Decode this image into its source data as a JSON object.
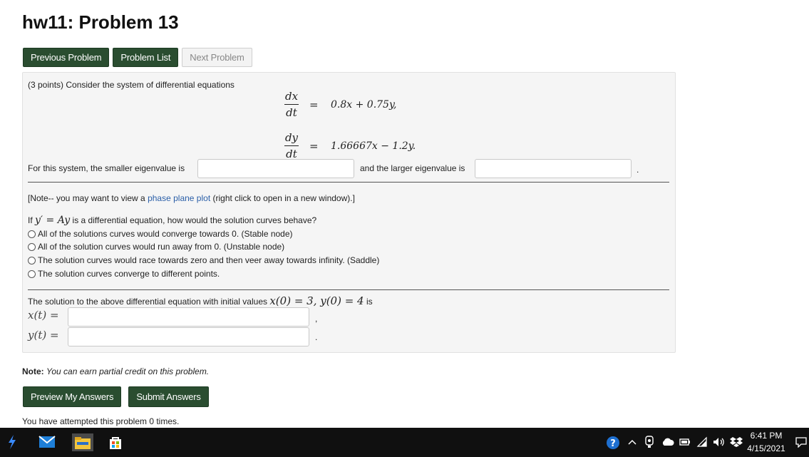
{
  "page": {
    "title": "hw11: Problem 13"
  },
  "nav": {
    "previous": "Previous Problem",
    "list": "Problem List",
    "next": "Next Problem"
  },
  "problem": {
    "intro": "(3 points) Consider the system of differential equations",
    "eq1_num": "dx",
    "eq1_den": "dt",
    "eq1_rhs": "0.8x + 0.75y,",
    "eq2_num": "dy",
    "eq2_den": "dt",
    "eq2_rhs": "1.66667x − 1.2y.",
    "equals": "=",
    "eigen_prefix": "For this system, the smaller eigenvalue is",
    "eigen_middle": "and the larger eigenvalue is",
    "eigen_end": ".",
    "note_prefix": "[Note-- you may want to view a",
    "note_link": "phase plane plot",
    "note_suffix": "(right click to open in a new window).]",
    "question_prefix": "If",
    "question_math": "y′ = Ay",
    "question_suffix": "is a differential equation, how would the solution curves behave?",
    "options": [
      "All of the solutions curves would converge towards 0. (Stable node)",
      "All of the solution curves would run away from 0. (Unstable node)",
      "The solution curves would race towards zero and then veer away towards infinity. (Saddle)",
      "The solution curves converge to different points."
    ],
    "ivp_prefix": "The solution to the above differential equation with initial values",
    "ivp_math": "x(0) = 3,  y(0) = 4",
    "ivp_suffix": "is",
    "x_label": "x(t) =",
    "x_end": ",",
    "y_label": "y(t) =",
    "y_end": "."
  },
  "note": {
    "bold": "Note:",
    "text": "You can earn partial credit on this problem."
  },
  "actions": {
    "preview": "Preview My Answers",
    "submit": "Submit Answers"
  },
  "attempts": "You have attempted this problem 0 times.",
  "taskbar": {
    "icons": [
      "app-launcher-icon",
      "mail-icon",
      "file-explorer-icon",
      "store-icon"
    ],
    "tray_icons": [
      "help-icon",
      "chevron-up-icon",
      "webcam-icon",
      "cloud-icon",
      "battery-icon",
      "wifi-icon",
      "volume-icon",
      "dropbox-icon",
      "notification-icon"
    ],
    "time": "6:41 PM",
    "date": "4/15/2021"
  },
  "colors": {
    "button_green": "#2a4d30",
    "link_blue": "#2b5fa8",
    "taskbar": "#101010"
  }
}
